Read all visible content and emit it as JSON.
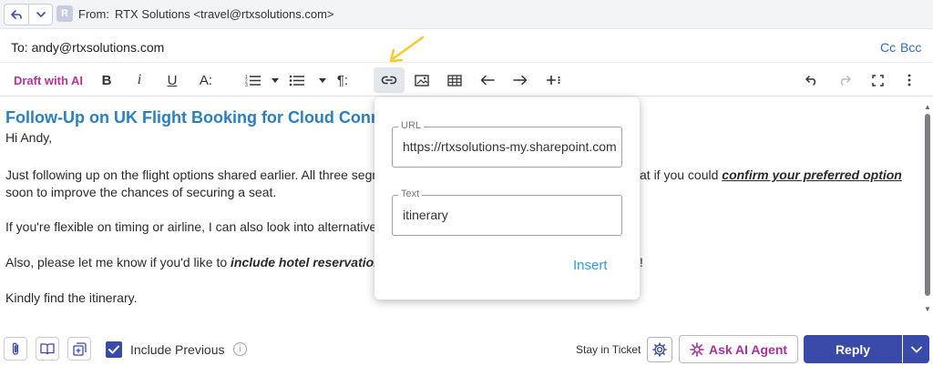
{
  "header": {
    "avatar_letter": "R",
    "from_label": "From:",
    "from_value": "RTX Solutions <travel@rtxsolutions.com>"
  },
  "recipients": {
    "to": "To: andy@rtxsolutions.com",
    "cc_label": "Cc",
    "bcc_label": "Bcc"
  },
  "toolbar": {
    "draft_ai": "Draft with AI",
    "bold": "B",
    "italic": "i",
    "underline": "U",
    "font_size": "A:",
    "paragraph": "¶:"
  },
  "email": {
    "subject": "Follow-Up on UK Flight Booking for Cloud Conne",
    "greeting": "Hi Andy,",
    "p1_start": "Just following up on the flight options shared earlier. All three segme",
    "p1_mid": "at if you could ",
    "p1_emph": "confirm your preferred option",
    "p1_line2": "soon to improve the chances of securing a seat.",
    "p2": "If you're flexible on timing or airline, I can also look into alternative r",
    "p3_start": "Also, please let me know if you'd like to ",
    "p3_emph": "include hotel reservations",
    "p3_end": "!",
    "p4": "Kindly find the itinerary."
  },
  "link_popup": {
    "url_label": "URL",
    "url_value": "https://rtxsolutions-my.sharepoint.com",
    "text_label": "Text",
    "text_value": "itinerary",
    "insert_label": "Insert"
  },
  "footer": {
    "include_previous_label": "Include Previous",
    "include_previous_checked": true,
    "stay_in_ticket_label": "Stay in Ticket",
    "ask_ai_label": "Ask AI Agent",
    "reply_label": "Reply"
  },
  "colors": {
    "accent": "#3a4aa8",
    "subject": "#2b7fc0",
    "ai": "#b5339d",
    "link": "#2d9fd8",
    "annotation_arrow": "#f2cc2c"
  }
}
